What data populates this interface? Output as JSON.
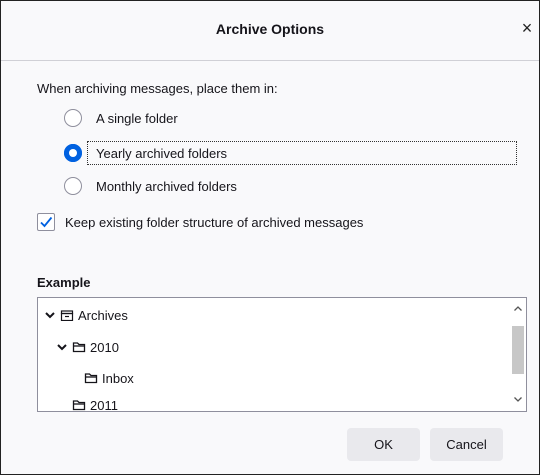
{
  "dialog": {
    "title": "Archive Options",
    "close_glyph": "×"
  },
  "options": {
    "lead": "When archiving messages, place them in:",
    "radios": [
      {
        "label": "A single folder",
        "selected": false
      },
      {
        "label": "Yearly archived folders",
        "selected": true
      },
      {
        "label": "Monthly archived folders",
        "selected": false
      }
    ],
    "keep_structure": {
      "label": "Keep existing folder structure of archived messages",
      "checked": true
    }
  },
  "example": {
    "title": "Example",
    "tree": [
      {
        "label": "Archives",
        "icon": "archive-icon",
        "expanded": true,
        "level": 0
      },
      {
        "label": "2010",
        "icon": "folder-icon",
        "expanded": true,
        "level": 1
      },
      {
        "label": "Inbox",
        "icon": "folder-icon",
        "expanded": false,
        "level": 2
      },
      {
        "label": "2011",
        "icon": "folder-icon",
        "expanded": false,
        "level": 1
      }
    ]
  },
  "buttons": {
    "ok": "OK",
    "cancel": "Cancel"
  },
  "colors": {
    "accent": "#0061e0",
    "background": "#f9f9fb",
    "button": "#e9e9ed"
  }
}
